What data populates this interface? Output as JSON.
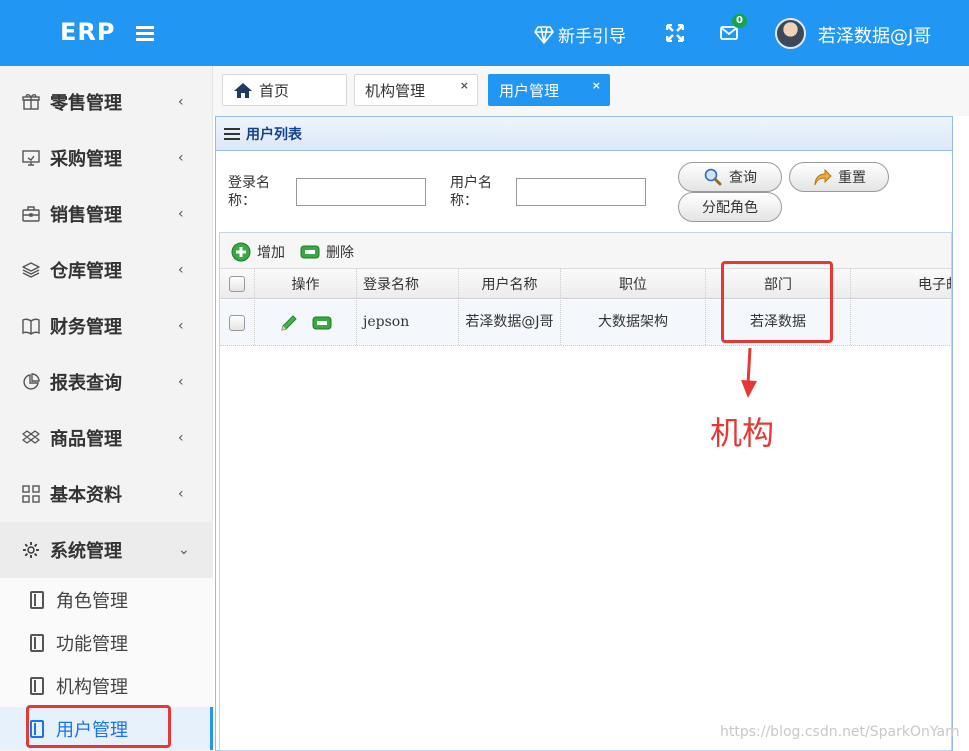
{
  "header": {
    "brand": "ERP",
    "guide_label": "新手引导",
    "mail_badge": "0",
    "username": "若泽数据@J哥"
  },
  "sidebar": {
    "items": [
      {
        "label": "零售管理",
        "icon": "gift-icon",
        "arrow": "‹"
      },
      {
        "label": "采购管理",
        "icon": "monitor-icon",
        "arrow": "‹"
      },
      {
        "label": "销售管理",
        "icon": "briefcase-icon",
        "arrow": "‹"
      },
      {
        "label": "仓库管理",
        "icon": "layers-icon",
        "arrow": "‹"
      },
      {
        "label": "财务管理",
        "icon": "book-icon",
        "arrow": "‹"
      },
      {
        "label": "报表查询",
        "icon": "pie-chart-icon",
        "arrow": "‹"
      },
      {
        "label": "商品管理",
        "icon": "dropbox-icon",
        "arrow": "‹"
      },
      {
        "label": "基本资料",
        "icon": "grid-icon",
        "arrow": "‹"
      },
      {
        "label": "系统管理",
        "icon": "gear-icon",
        "arrow": "⌄"
      }
    ],
    "sub_items": [
      {
        "label": "角色管理",
        "icon": "notebook-icon"
      },
      {
        "label": "功能管理",
        "icon": "notebook-icon"
      },
      {
        "label": "机构管理",
        "icon": "notebook-icon"
      },
      {
        "label": "用户管理",
        "icon": "notebook-icon",
        "active": true
      }
    ]
  },
  "tabs": [
    {
      "label": "首页",
      "icon": "home-icon",
      "closable": false
    },
    {
      "label": "机构管理",
      "closable": true,
      "close": "×"
    },
    {
      "label": "用户管理",
      "closable": true,
      "close": "×",
      "active": true
    }
  ],
  "panel": {
    "title": "用户列表",
    "search": {
      "login_label": "登录名\n称：",
      "login_value": "",
      "user_label": "用户名\n称：",
      "user_value": "",
      "query_button": "查询",
      "reset_button": "重置",
      "assign_role_button": "分配角色"
    },
    "toolbar": {
      "add_label": "增加",
      "delete_label": "删除"
    },
    "columns": [
      "操作",
      "登录名称",
      "用户名称",
      "职位",
      "部门",
      "电子邮"
    ],
    "rows": [
      {
        "login": "jepson",
        "username": "若泽数据@J哥",
        "position": "大数据架构",
        "department": "若泽数据",
        "email": ""
      }
    ]
  },
  "annotation": {
    "text": "机构",
    "color": "#e53935"
  },
  "watermark": "https://blog.csdn.net/SparkOnYarn",
  "colors": {
    "topbar": "#2196f3",
    "accent": "#2196f3",
    "annotation": "#e53935"
  }
}
